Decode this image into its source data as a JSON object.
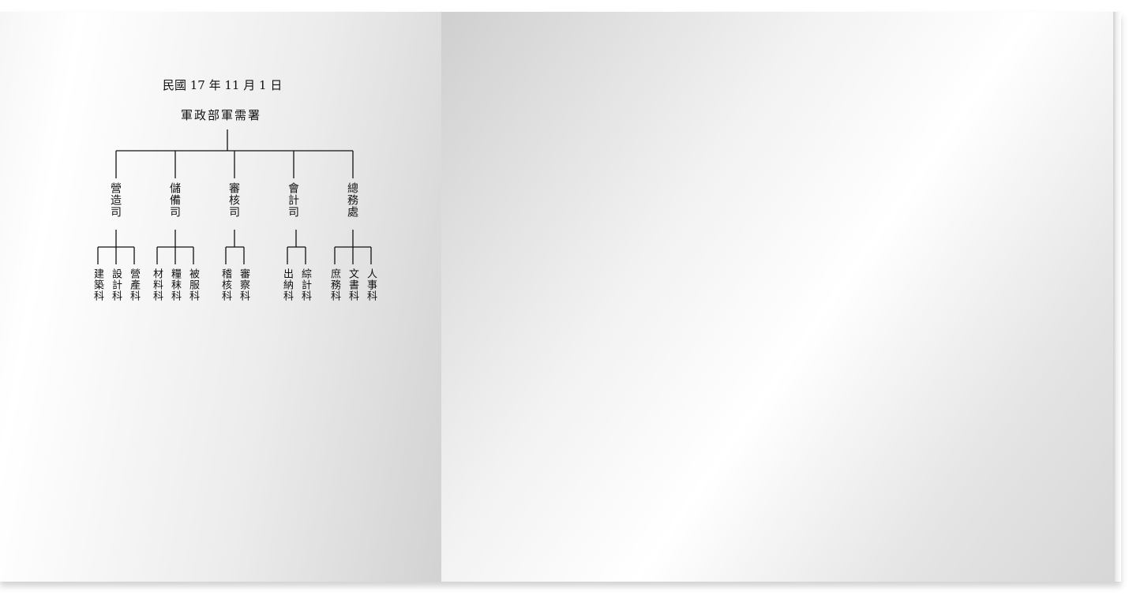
{
  "chart": {
    "date": "民國 17 年 11 月 1 日",
    "root": "軍政部軍需署",
    "departments": [
      {
        "name": "營造司",
        "sections": [
          "建築科",
          "設計科",
          "營產科"
        ]
      },
      {
        "name": "儲備司",
        "sections": [
          "材料科",
          "糧秣科",
          "被服科"
        ]
      },
      {
        "name": "審核司",
        "sections": [
          "稽核科",
          "審察科"
        ]
      },
      {
        "name": "會計司",
        "sections": [
          "出納科",
          "綜計科"
        ]
      },
      {
        "name": "總務處",
        "sections": [
          "庶務科",
          "文書科",
          "人事科"
        ]
      }
    ]
  }
}
